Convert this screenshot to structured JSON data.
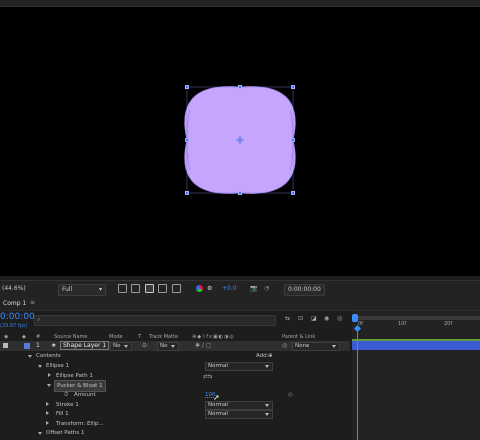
{
  "viewer": {
    "toolbar": {
      "zoom": "(44.6%)",
      "resolution": "Full",
      "exposure": "+0.0",
      "timecode": "0:00:00:00"
    }
  },
  "timeline": {
    "tab_label": "Comp 1",
    "current_time": "0:00:00",
    "fps": "(29.97 fps)",
    "search_placeholder": "",
    "columns": {
      "num": "#",
      "source_name": "Source Name",
      "mode": "Mode",
      "t": "T",
      "track_matte": "Track Matte",
      "parent": "Parent & Link"
    },
    "ruler": [
      "0f",
      "10f",
      "20f"
    ],
    "layer": {
      "index": "1",
      "name": "Shape Layer 1",
      "mode": "No",
      "track_matte": "No",
      "parent": "None"
    },
    "contents_label": "Contents",
    "add_label": "Add:",
    "rows": [
      {
        "label": "Ellipse 1",
        "value": "Normal"
      },
      {
        "label": "Ellipse Path 1"
      },
      {
        "label": "Pucker & Bloat 1"
      },
      {
        "label": "Amount",
        "value": "100"
      },
      {
        "label": "Stroke 1",
        "value": "Normal"
      },
      {
        "label": "Fill 1",
        "value": "Normal"
      },
      {
        "label": "Transform: Ellip..."
      },
      {
        "label": "Offset Paths 1"
      }
    ]
  },
  "colors": {
    "shape_fill": "#c6a5ff",
    "handle": "#4f6fe6",
    "value_blue": "#3a8cff",
    "layer_label": "#5b7ad8",
    "track_bar": "#3b5bd1"
  }
}
